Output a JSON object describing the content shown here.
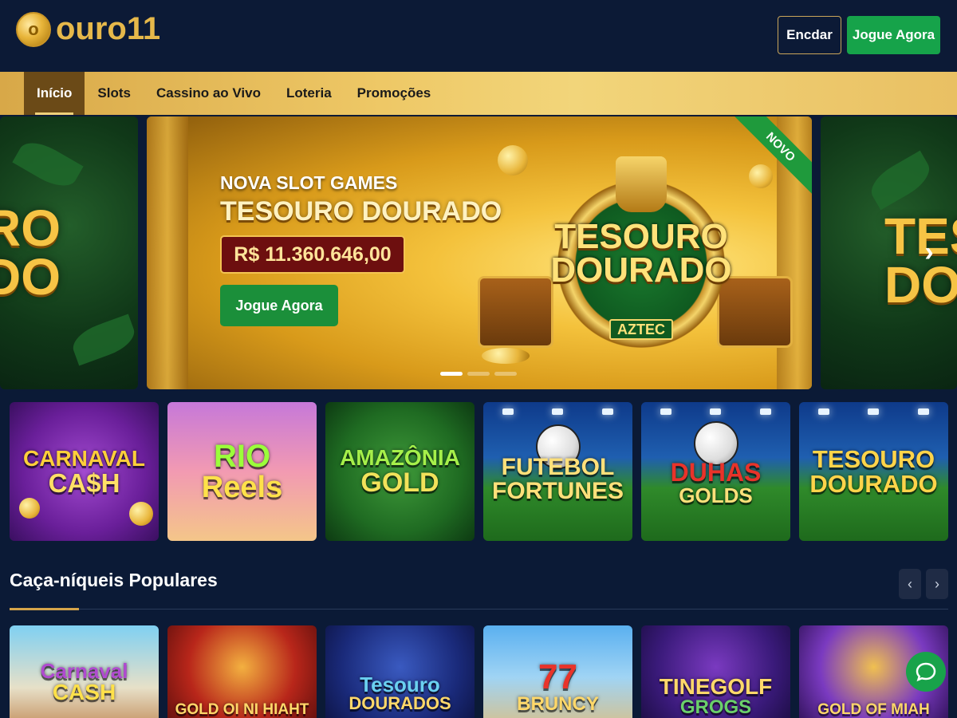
{
  "header": {
    "logo_mark": "o",
    "logo_text": "ouro11",
    "login_label": "Encdar",
    "play_label": "Jogue Agora"
  },
  "nav": {
    "items": [
      {
        "label": "Início",
        "active": true
      },
      {
        "label": "Slots",
        "active": false
      },
      {
        "label": "Cassino ao Vivo",
        "active": false
      },
      {
        "label": "Loteria",
        "active": false
      },
      {
        "label": "Promoções",
        "active": false
      }
    ]
  },
  "hero": {
    "subtitle": "NOVA SLOT GAMES",
    "title": "TESOURO DOURADO",
    "jackpot": "R$ 11.360.646,00",
    "cta": "Jogue Agora",
    "emblem_title_line1": "TESOURO",
    "emblem_title_line2": "DOURADO",
    "emblem_sub": "AZTEC",
    "ribbon": "NOVO",
    "side_left_line1": "RO",
    "side_left_line2": "DO",
    "side_right_line1": "TES",
    "side_right_line2": "DOU",
    "next_arrow": "›",
    "dots": [
      true,
      false,
      false
    ]
  },
  "featured_games": [
    {
      "line1": "CARNAVAL",
      "line2": "CA$H"
    },
    {
      "line1": "RIO",
      "line2": "Reels"
    },
    {
      "line1": "AMAZÔNIA",
      "line2": "GOLD"
    },
    {
      "line1": "FUTEBOL",
      "line2": "FORTUNES"
    },
    {
      "line1": "DUHAS",
      "line2": "GOLDS"
    },
    {
      "line1": "TESOURO",
      "line2": "DOURADO"
    }
  ],
  "popular_section": {
    "title": "Caça-níqueis Populares",
    "prev_arrow": "‹",
    "next_arrow": "›"
  },
  "popular_games": [
    {
      "line1": "Carnaval",
      "line2": "CASH"
    },
    {
      "line1": "GOLD OI NI HIAHT",
      "line2": ""
    },
    {
      "line1": "Tesouro",
      "line2": "DOURADOS"
    },
    {
      "line1": "77",
      "line2": "BRUNCY"
    },
    {
      "line1": "TINEGOLF",
      "line2": "GROGS"
    },
    {
      "line1": "GOLD OF MIAH",
      "line2": ""
    }
  ],
  "colors": {
    "background": "#0b1a36",
    "gold": "#e6b84a",
    "green": "#16a34a"
  },
  "icons": {
    "chat": "chat-bubble-icon",
    "logo": "gold-coin-icon"
  }
}
